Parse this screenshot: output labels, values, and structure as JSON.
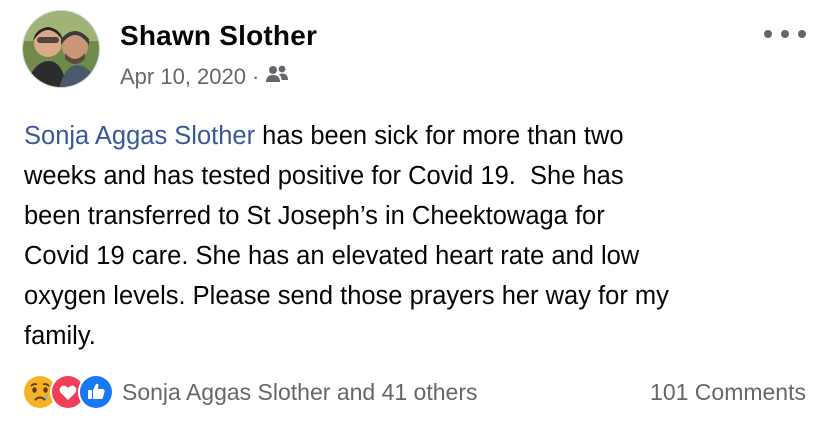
{
  "post": {
    "author": "Shawn Slother",
    "date": "Apr 10, 2020",
    "separator": "·",
    "audience_icon": "friends-icon",
    "more_icon": "more-options-icon",
    "mention": "Sonja Aggas Slother",
    "text": " has been sick for more than two\nweeks and has tested positive for Covid 19.  She has\nbeen transferred to St Joseph’s in Cheektowaga for\nCovid 19 care. She has an elevated heart rate and low\noxygen levels. Please send those prayers her way for my\nfamily."
  },
  "footer": {
    "reaction_icons": [
      "sad-reaction-icon",
      "love-reaction-icon",
      "like-reaction-icon"
    ],
    "reactors": "Sonja Aggas Slother and 41 others",
    "comments": "101 Comments"
  },
  "colors": {
    "mention": "#385898",
    "secondary_text": "#65676b",
    "like": "#1877f2",
    "love": "#f33e58",
    "sad": "#f7b125"
  }
}
